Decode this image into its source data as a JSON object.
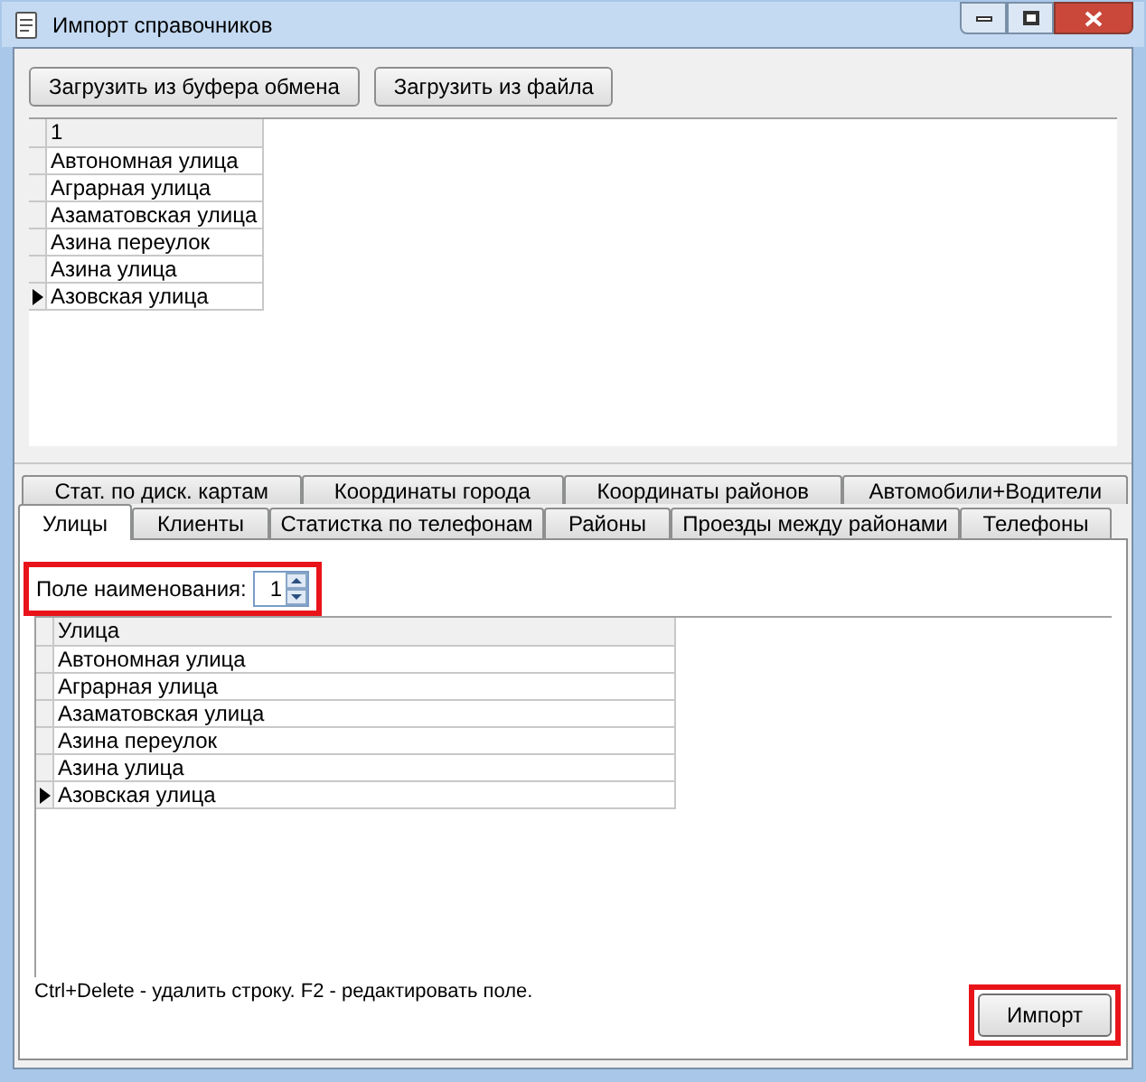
{
  "window": {
    "title": "Импорт справочников"
  },
  "toolbar": {
    "buttons": [
      "Загрузить из буфера обмена",
      "Загрузить из файла"
    ]
  },
  "source_grid": {
    "columns": [
      "1"
    ],
    "rows": [
      {
        "cells": [
          "Автономная улица"
        ],
        "current": false
      },
      {
        "cells": [
          "Аграрная улица"
        ],
        "current": false
      },
      {
        "cells": [
          "Азаматовская улица"
        ],
        "current": false
      },
      {
        "cells": [
          "Азина переулок"
        ],
        "current": false
      },
      {
        "cells": [
          "Азина улица"
        ],
        "current": false
      },
      {
        "cells": [
          "Азовская улица"
        ],
        "current": true
      }
    ]
  },
  "back_tabs": [
    {
      "label": "Стат. по диск. картам",
      "selected": false
    },
    {
      "label": "Координаты города",
      "selected": false
    },
    {
      "label": "Координаты районов",
      "selected": false
    },
    {
      "label": "Автомобили+Водители",
      "selected": false
    }
  ],
  "front_tabs": [
    {
      "label": "Улицы",
      "selected": true
    },
    {
      "label": "Клиенты",
      "selected": false
    },
    {
      "label": "Статистка по телефонам",
      "selected": false
    },
    {
      "label": "Районы",
      "selected": false
    },
    {
      "label": "Проезды между районами",
      "selected": false
    },
    {
      "label": "Телефоны",
      "selected": false
    }
  ],
  "name_field": {
    "label": "Поле наименования:",
    "value": "1"
  },
  "streets_grid": {
    "columns": [
      "Улица"
    ],
    "rows": [
      {
        "cells": [
          "Автономная улица"
        ],
        "current": false
      },
      {
        "cells": [
          "Аграрная улица"
        ],
        "current": false
      },
      {
        "cells": [
          "Азаматовская улица"
        ],
        "current": false
      },
      {
        "cells": [
          "Азина переулок"
        ],
        "current": false
      },
      {
        "cells": [
          "Азина улица"
        ],
        "current": false
      },
      {
        "cells": [
          "Азовская улица"
        ],
        "current": true
      }
    ]
  },
  "hint": "Ctrl+Delete - удалить строку. F2 - редактировать поле.",
  "import_button": "Импорт"
}
